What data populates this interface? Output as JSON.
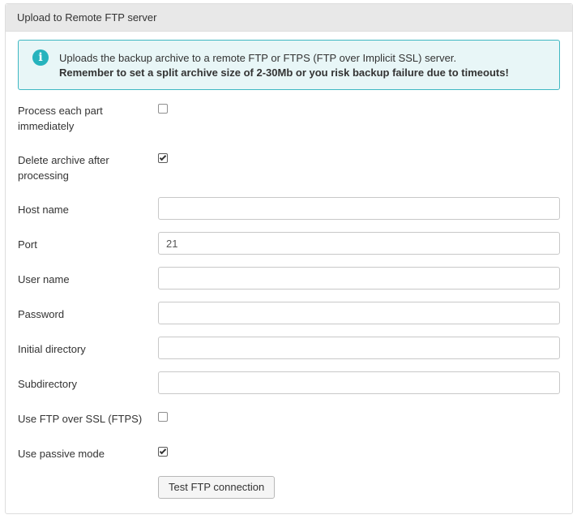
{
  "panel": {
    "title": "Upload to Remote FTP server"
  },
  "alert": {
    "icon": "info-icon",
    "line1": "Uploads the backup archive to a remote FTP or FTPS (FTP over Implicit SSL) server.",
    "line2": "Remember to set a split archive size of 2-30Mb or you risk backup failure due to timeouts!",
    "accent_color": "#26b3bd"
  },
  "fields": {
    "process_each_part": {
      "label": "Process each part immediately",
      "checked": false
    },
    "delete_archive": {
      "label": "Delete archive after processing",
      "checked": true
    },
    "host_name": {
      "label": "Host name",
      "value": ""
    },
    "port": {
      "label": "Port",
      "value": "21"
    },
    "user_name": {
      "label": "User name",
      "value": ""
    },
    "password": {
      "label": "Password",
      "value": ""
    },
    "initial_directory": {
      "label": "Initial directory",
      "value": ""
    },
    "subdirectory": {
      "label": "Subdirectory",
      "value": ""
    },
    "use_ftps": {
      "label": "Use FTP over SSL (FTPS)",
      "checked": false
    },
    "passive_mode": {
      "label": "Use passive mode",
      "checked": true
    }
  },
  "actions": {
    "test_connection_label": "Test FTP connection"
  }
}
